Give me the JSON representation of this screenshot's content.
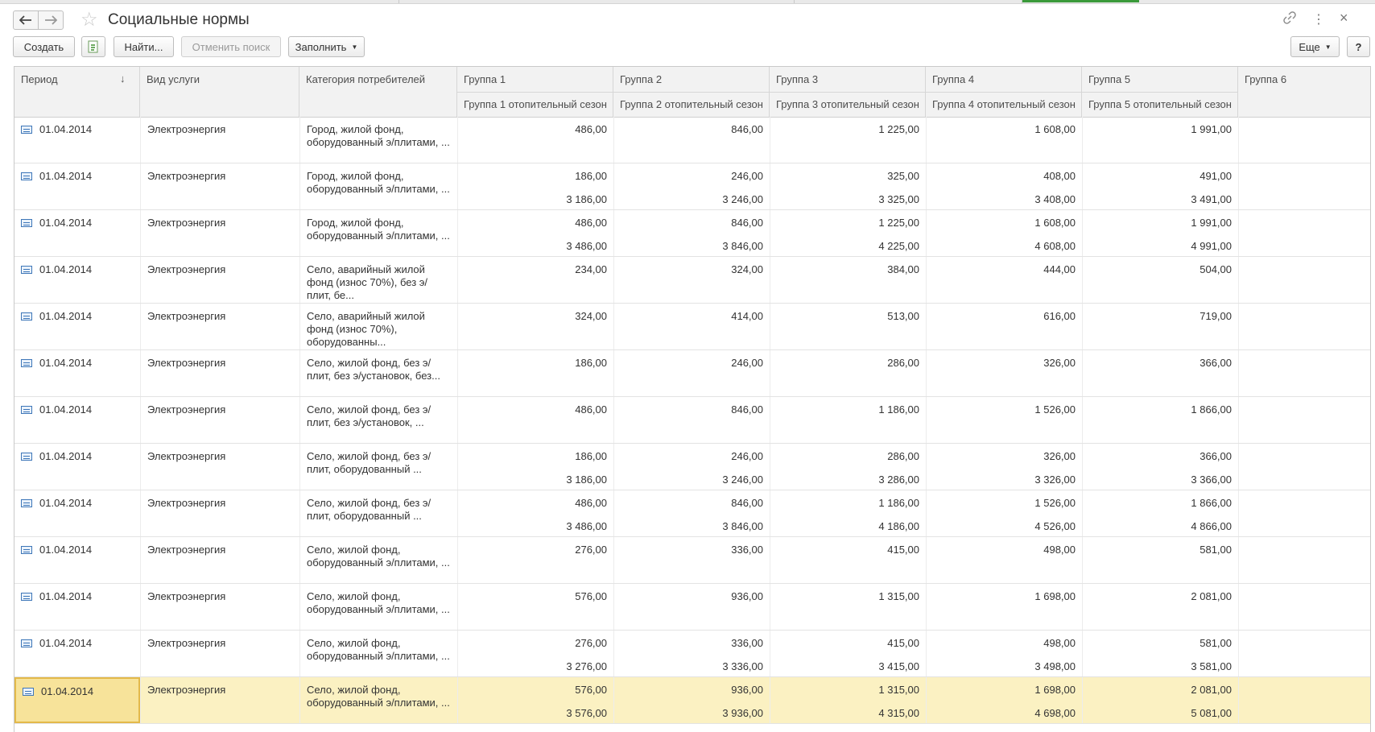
{
  "window": {
    "title": "Социальные нормы",
    "icons": [
      "back-arrow-icon",
      "forward-arrow-icon",
      "star-icon",
      "link-icon",
      "more-vertical-icon",
      "close-icon"
    ]
  },
  "toolbar": {
    "create": "Создать",
    "find": "Найти...",
    "cancel_search": "Отменить поиск",
    "fill": "Заполнить",
    "more": "Еще",
    "help": "?"
  },
  "columns": {
    "period": "Период",
    "service": "Вид услуги",
    "category": "Категория потребителей",
    "groups": [
      "Группа 1",
      "Группа 2",
      "Группа 3",
      "Группа 4",
      "Группа 5",
      "Группа 6"
    ],
    "heating": [
      "Группа 1 отопительный сезон",
      "Группа 2 отопительный сезон",
      "Группа 3 отопительный сезон",
      "Группа 4 отопительный сезон",
      "Группа 5 отопительный сезон"
    ]
  },
  "rows": [
    {
      "period": "01.04.2014",
      "service": "Электроэнергия",
      "category": "Город, жилой фонд, оборудованный э/плитами, ...",
      "v": [
        "486,00",
        "846,00",
        "1 225,00",
        "1 608,00",
        "1 991,00"
      ],
      "h": [
        "",
        "",
        "",
        "",
        ""
      ]
    },
    {
      "period": "01.04.2014",
      "service": "Электроэнергия",
      "category": "Город, жилой фонд, оборудованный э/плитами, ...",
      "v": [
        "186,00",
        "246,00",
        "325,00",
        "408,00",
        "491,00"
      ],
      "h": [
        "3 186,00",
        "3 246,00",
        "3 325,00",
        "3 408,00",
        "3 491,00"
      ]
    },
    {
      "period": "01.04.2014",
      "service": "Электроэнергия",
      "category": "Город, жилой фонд, оборудованный э/плитами, ...",
      "v": [
        "486,00",
        "846,00",
        "1 225,00",
        "1 608,00",
        "1 991,00"
      ],
      "h": [
        "3 486,00",
        "3 846,00",
        "4 225,00",
        "4 608,00",
        "4 991,00"
      ]
    },
    {
      "period": "01.04.2014",
      "service": "Электроэнергия",
      "category": "Село, аварийный жилой фонд (износ 70%), без э/плит, бе...",
      "v": [
        "234,00",
        "324,00",
        "384,00",
        "444,00",
        "504,00"
      ],
      "h": [
        "",
        "",
        "",
        "",
        ""
      ]
    },
    {
      "period": "01.04.2014",
      "service": "Электроэнергия",
      "category": "Село, аварийный жилой фонд (износ 70%), оборудованны...",
      "v": [
        "324,00",
        "414,00",
        "513,00",
        "616,00",
        "719,00"
      ],
      "h": [
        "",
        "",
        "",
        "",
        ""
      ]
    },
    {
      "period": "01.04.2014",
      "service": "Электроэнергия",
      "category": "Село, жилой фонд, без э/плит, без э/установок, без...",
      "v": [
        "186,00",
        "246,00",
        "286,00",
        "326,00",
        "366,00"
      ],
      "h": [
        "",
        "",
        "",
        "",
        ""
      ]
    },
    {
      "period": "01.04.2014",
      "service": "Электроэнергия",
      "category": "Село, жилой фонд, без э/плит, без э/установок, ...",
      "v": [
        "486,00",
        "846,00",
        "1 186,00",
        "1 526,00",
        "1 866,00"
      ],
      "h": [
        "",
        "",
        "",
        "",
        ""
      ]
    },
    {
      "period": "01.04.2014",
      "service": "Электроэнергия",
      "category": "Село, жилой фонд, без э/плит, оборудованный ...",
      "v": [
        "186,00",
        "246,00",
        "286,00",
        "326,00",
        "366,00"
      ],
      "h": [
        "3 186,00",
        "3 246,00",
        "3 286,00",
        "3 326,00",
        "3 366,00"
      ]
    },
    {
      "period": "01.04.2014",
      "service": "Электроэнергия",
      "category": "Село, жилой фонд, без э/плит, оборудованный ...",
      "v": [
        "486,00",
        "846,00",
        "1 186,00",
        "1 526,00",
        "1 866,00"
      ],
      "h": [
        "3 486,00",
        "3 846,00",
        "4 186,00",
        "4 526,00",
        "4 866,00"
      ]
    },
    {
      "period": "01.04.2014",
      "service": "Электроэнергия",
      "category": "Село, жилой фонд, оборудованный э/плитами, ...",
      "v": [
        "276,00",
        "336,00",
        "415,00",
        "498,00",
        "581,00"
      ],
      "h": [
        "",
        "",
        "",
        "",
        ""
      ]
    },
    {
      "period": "01.04.2014",
      "service": "Электроэнергия",
      "category": "Село, жилой фонд, оборудованный э/плитами, ...",
      "v": [
        "576,00",
        "936,00",
        "1 315,00",
        "1 698,00",
        "2 081,00"
      ],
      "h": [
        "",
        "",
        "",
        "",
        ""
      ]
    },
    {
      "period": "01.04.2014",
      "service": "Электроэнергия",
      "category": "Село, жилой фонд, оборудованный э/плитами, ...",
      "v": [
        "276,00",
        "336,00",
        "415,00",
        "498,00",
        "581,00"
      ],
      "h": [
        "3 276,00",
        "3 336,00",
        "3 415,00",
        "3 498,00",
        "3 581,00"
      ]
    },
    {
      "period": "01.04.2014",
      "service": "Электроэнергия",
      "category": "Село, жилой фонд, оборудованный э/плитами, ...",
      "v": [
        "576,00",
        "936,00",
        "1 315,00",
        "1 698,00",
        "2 081,00"
      ],
      "h": [
        "3 576,00",
        "3 936,00",
        "4 315,00",
        "4 698,00",
        "5 081,00"
      ],
      "selected": true
    }
  ]
}
